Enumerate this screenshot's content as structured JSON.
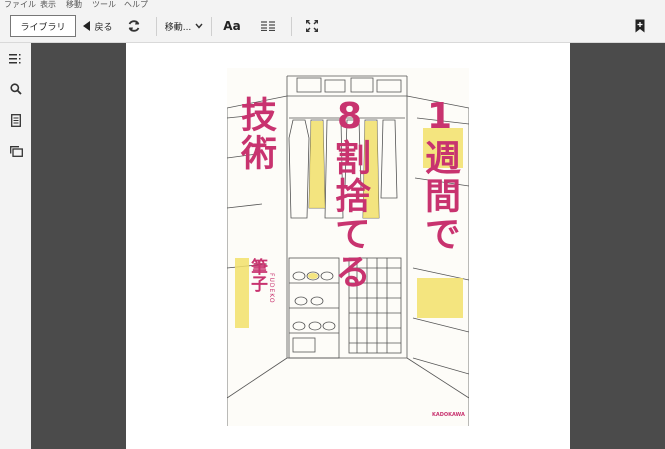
{
  "menu": [
    "ファイル",
    "表示",
    "移動",
    "ツール",
    "ヘルプ"
  ],
  "toolbar": {
    "library_label": "ライブラリ",
    "back_label": "戻る",
    "move_label": "移動...",
    "font_label": "Aa"
  },
  "book": {
    "title_col1": "1週間で",
    "title_col2": "8割捨てる",
    "title_col3": "技術",
    "author": "筆子",
    "author_roman": "FUDEKO",
    "publisher": "KADOKAWA"
  },
  "colors": {
    "accent": "#c8336f",
    "viewer_bg": "#4b4b4b",
    "toolbar_bg": "#f3f3f3"
  }
}
